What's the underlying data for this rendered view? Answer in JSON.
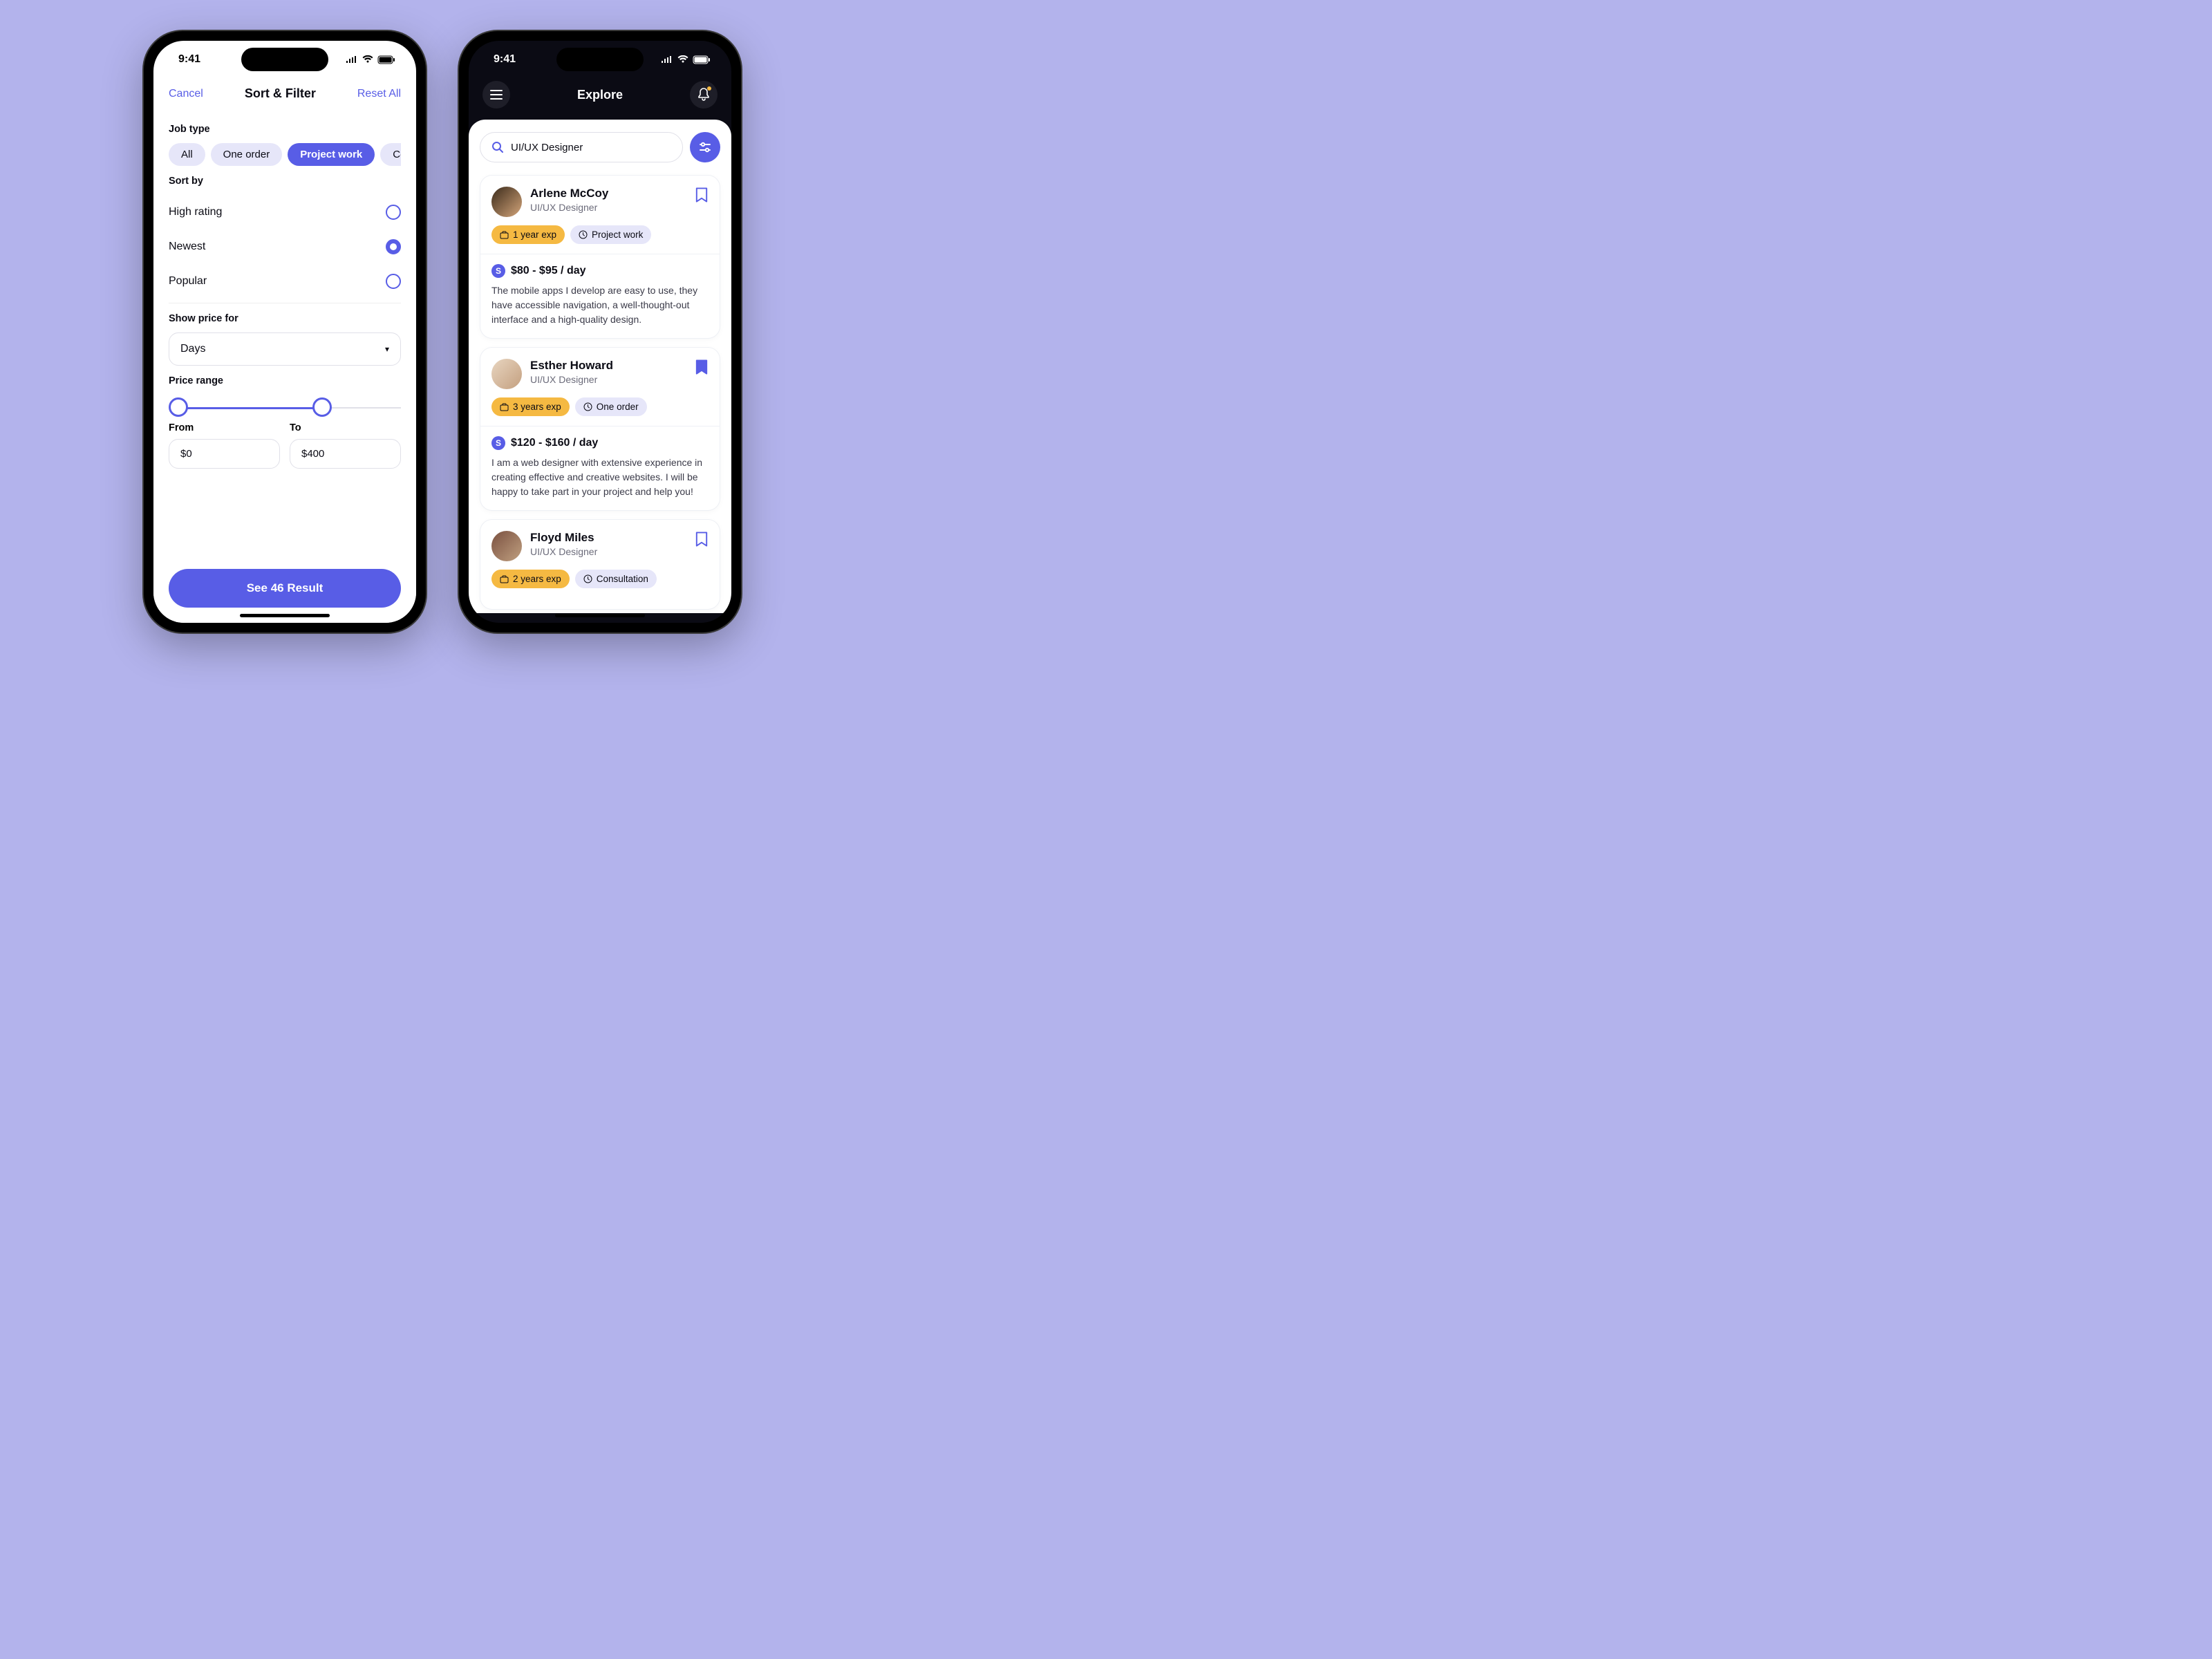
{
  "status": {
    "time": "9:41"
  },
  "filter": {
    "cancel": "Cancel",
    "title": "Sort & Filter",
    "reset": "Reset All",
    "job_type_label": "Job type",
    "chips": [
      "All",
      "One order",
      "Project work",
      "Cons"
    ],
    "sort_label": "Sort by",
    "sort_options": [
      "High rating",
      "Newest",
      "Popular"
    ],
    "price_period_label": "Show price for",
    "price_period_value": "Days",
    "price_range_label": "Price range",
    "from_label": "From",
    "to_label": "To",
    "from_value": "$0",
    "to_value": "$400",
    "cta": "See 46 Result"
  },
  "explore": {
    "title": "Explore",
    "search_value": "UI/UX Designer",
    "cards": [
      {
        "name": "Arlene McCoy",
        "role": "UI/UX Designer",
        "exp": "1 year exp",
        "work": "Project work",
        "price": "$80 - $95 / day",
        "desc": "The mobile apps I develop are easy to use, they have accessible navigation, a well-thought-out interface and a high-quality design.",
        "bookmarked": false
      },
      {
        "name": "Esther Howard",
        "role": "UI/UX Designer",
        "exp": "3 years exp",
        "work": "One order",
        "price": "$120 - $160 / day",
        "desc": "I am a web designer with extensive experience in creating effective and creative websites. I will be happy to take part in your project and help you!",
        "bookmarked": true
      },
      {
        "name": "Floyd Miles",
        "role": "UI/UX Designer",
        "exp": "2 years exp",
        "work": "Consultation",
        "price": "",
        "desc": "",
        "bookmarked": false
      }
    ]
  }
}
